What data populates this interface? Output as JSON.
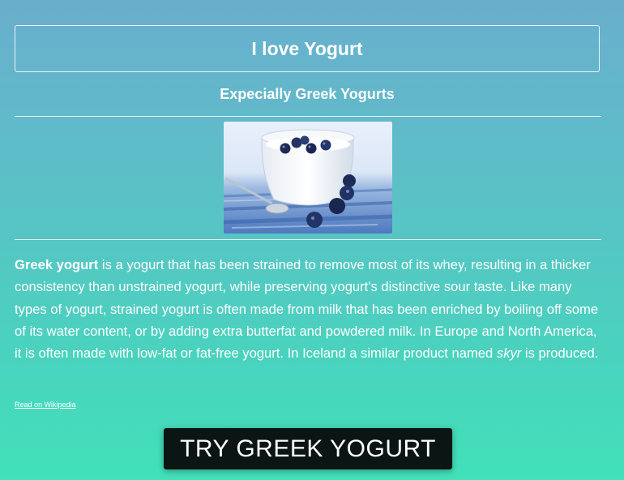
{
  "header": {
    "title": "I love Yogurt",
    "subtitle": "Expecially Greek Yogurts"
  },
  "image": {
    "icon": "greek-yogurt-with-blueberries-photo"
  },
  "article": {
    "term": "Greek yogurt",
    "text_part1": " is a yogurt that has been strained to remove most of its whey, resulting in a thicker consistency than unstrained yogurt, while preserving yogurt's distinctive sour taste. Like many types of yogurt, strained yogurt is often made from milk that has been enriched by boiling off some of its water content, or by adding extra butterfat and powdered milk. In Europe and North America, it is often made with low-fat or fat-free yogurt. In Iceland a similar product named ",
    "term_skyr": "skyr",
    "text_part2": " is produced."
  },
  "links": {
    "wikipedia": "Read on Wikipedia"
  },
  "cta": {
    "label": "TRY GREEK YOGURT"
  },
  "colors": {
    "gradient_top": "#6aaecd",
    "gradient_bottom": "#41e1b9",
    "button_bg": "#0b1513",
    "text": "#ffffff"
  }
}
